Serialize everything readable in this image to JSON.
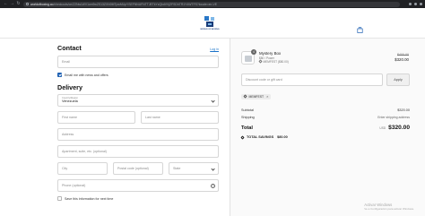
{
  "browser": {
    "url_host": "worldofboxing.co",
    "url_path": "/checkouts/cn/Z2NwLWV1cm9wZS13ZXN0MTpwMUpYSEFNNUFNTTJETkYzQkdVVjZFSDhTR1Y4WTFS?locale=en-VE"
  },
  "store": {
    "logo_text": "WORLD OF BOXING"
  },
  "contact": {
    "title": "Contact",
    "login_label": "Log in",
    "email_placeholder": "Email",
    "news_label": "Email me with news and offers",
    "news_checked": true
  },
  "delivery": {
    "title": "Delivery",
    "country_label": "Country/Region",
    "country_value": "Venezuela",
    "first_name_placeholder": "First name",
    "last_name_placeholder": "Last name",
    "address_placeholder": "Address",
    "apartment_placeholder": "Apartment, suite, etc. (optional)",
    "city_placeholder": "City",
    "postal_placeholder": "Postal code (optional)",
    "state_placeholder": "State",
    "phone_placeholder": "Phone (optional)",
    "save_label": "Save this information for next time",
    "save_checked": false
  },
  "summary": {
    "product": {
      "quantity": "4",
      "name": "Mystery Box",
      "variant": "$80 / Power",
      "discount": "MEMFEST ($80.00)",
      "original_price": "$400.00",
      "price": "$320.00"
    },
    "discount_placeholder": "Discount code or gift card",
    "apply_label": "Apply",
    "applied_code": "MEMFEST",
    "subtotal_label": "Subtotal",
    "subtotal_value": "$320.00",
    "shipping_label": "Shipping",
    "shipping_value": "Enter shipping address",
    "total_label": "Total",
    "currency": "USD",
    "total_value": "$320.00",
    "savings_label": "TOTAL SAVINGS",
    "savings_value": "$80.00"
  },
  "os_notice": {
    "line1": "Activar Windows",
    "line2": "Ve a Configuración para activar Windows."
  },
  "colors": {
    "accent": "#1c5fb2",
    "link": "#1a73c9"
  }
}
